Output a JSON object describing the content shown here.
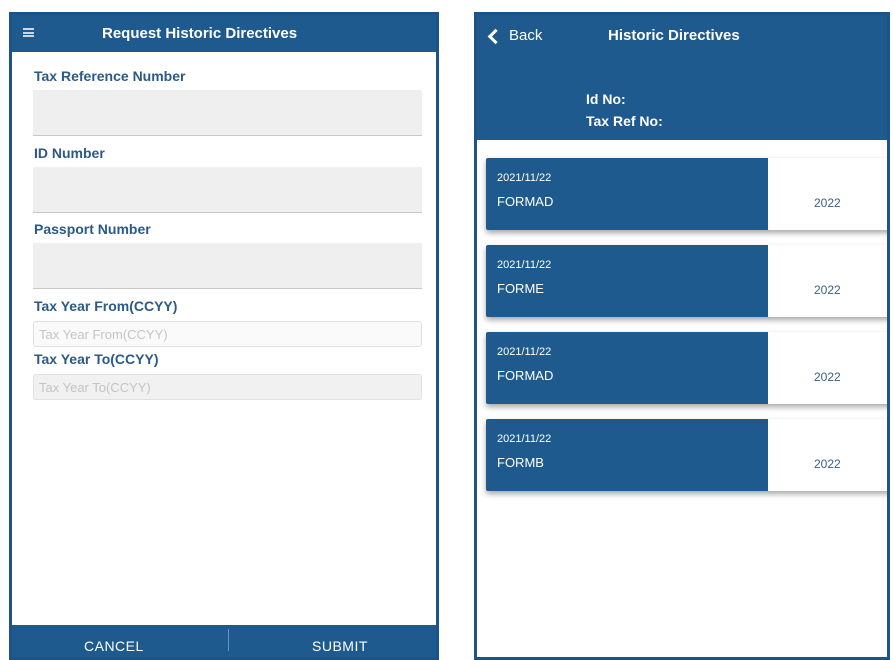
{
  "request_screen": {
    "title": "Request Historic Directives",
    "fields": {
      "tax_ref": {
        "label": "Tax Reference Number",
        "value": ""
      },
      "id_number": {
        "label": "ID Number",
        "value": ""
      },
      "passport": {
        "label": "Passport Number",
        "value": ""
      },
      "tax_year_from": {
        "label": "Tax Year From(CCYY)",
        "value": "",
        "placeholder": "Tax Year From(CCYY)"
      },
      "tax_year_to": {
        "label": "Tax Year To(CCYY)",
        "value": "",
        "placeholder": "Tax Year To(CCYY)"
      }
    },
    "footer": {
      "cancel_label": "CANCEL",
      "submit_label": "SUBMIT"
    }
  },
  "history_screen": {
    "back_label": "Back",
    "title": "Historic Directives",
    "id_label": "Id No:",
    "taxref_label": "Tax Ref No:",
    "directives": [
      {
        "date": "2021/11/22",
        "form": "FORMAD",
        "year": "2022"
      },
      {
        "date": "2021/11/22",
        "form": "FORME",
        "year": "2022"
      },
      {
        "date": "2021/11/22",
        "form": "FORMAD",
        "year": "2022"
      },
      {
        "date": "2021/11/22",
        "form": "FORMB",
        "year": "2022"
      }
    ]
  },
  "colors": {
    "primary": "#1f5a8f",
    "label": "#2b5a86",
    "input_bg": "#efefef"
  },
  "icons": {
    "menu": "hamburger-menu-icon",
    "back": "chevron-left-icon"
  }
}
